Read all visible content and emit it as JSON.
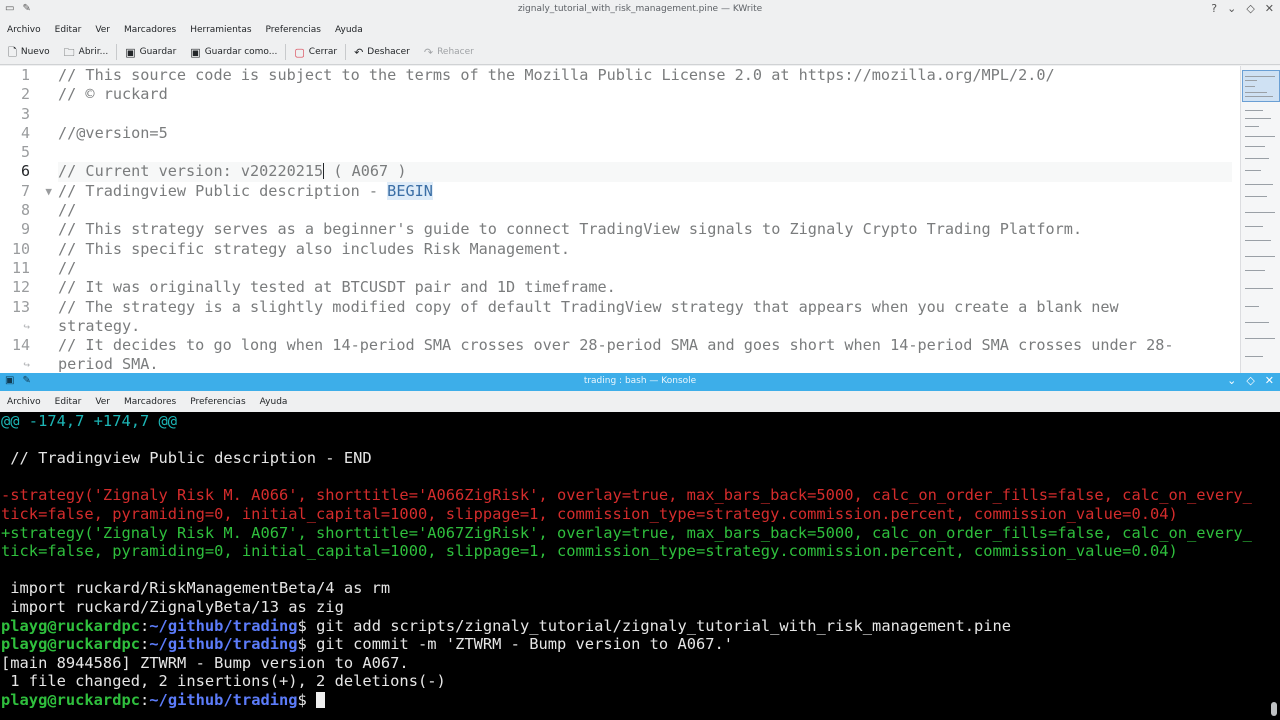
{
  "kwrite": {
    "title": "zignaly_tutorial_with_risk_management.pine — KWrite",
    "menu": [
      "Archivo",
      "Editar",
      "Ver",
      "Marcadores",
      "Herramientas",
      "Preferencias",
      "Ayuda"
    ],
    "toolbar": {
      "new_label": "Nuevo",
      "open_label": "Abrir...",
      "save_label": "Guardar",
      "save_as_label": "Guardar como...",
      "close_label": "Cerrar",
      "undo_label": "Deshacer",
      "redo_label": "Rehacer"
    },
    "gutter": [
      "1",
      "2",
      "3",
      "4",
      "5",
      "6",
      "7",
      "8",
      "9",
      "10",
      "11",
      "12",
      "13",
      "",
      "14",
      ""
    ],
    "lines": {
      "l1": "// This source code is subject to the terms of the Mozilla Public License 2.0 at https://mozilla.org/MPL/2.0/",
      "l2": "// © ruckard",
      "l3": "",
      "l4": "//@version=5",
      "l5": "",
      "l6_before_cursor": "// Current version: v20220215",
      "l6_after_cursor": " ( A067 )",
      "l7_prefix": "// Tradingview Public description - ",
      "l7_highlight": "BEGIN",
      "l8": "//",
      "l9": "// This strategy serves as a beginner's guide to connect TradingView signals to Zignaly Crypto Trading Platform.",
      "l10": "// This specific strategy also includes Risk Management.",
      "l11": "//",
      "l12": "// It was originally tested at BTCUSDT pair and 1D timeframe.",
      "l13a": "// The strategy is a slightly modified copy of default TradingView strategy that appears when you create a blank new",
      "l13b": "strategy.",
      "l14a": "// It decides to go long when 14-period SMA crosses over 28-period SMA and goes short when 14-period SMA crosses under 28-",
      "l14b": "period SMA."
    }
  },
  "konsole": {
    "title": "trading : bash — Konsole",
    "menu": [
      "Archivo",
      "Editar",
      "Ver",
      "Marcadores",
      "Preferencias",
      "Ayuda"
    ],
    "terminal": {
      "hunk": "@@ -174,7 +174,7 @@",
      "blank1": "",
      "ctx1": " // Tradingview Public description - END",
      "blank2": "",
      "del1": "-strategy('Zignaly Risk M. A066', shorttitle='A066ZigRisk', overlay=true, max_bars_back=5000, calc_on_order_fills=false, calc_on_every_",
      "del2": "tick=false, pyramiding=0, initial_capital=1000, slippage=1, commission_type=strategy.commission.percent, commission_value=0.04)",
      "add1": "+strategy('Zignaly Risk M. A067', shorttitle='A067ZigRisk', overlay=true, max_bars_back=5000, calc_on_order_fills=false, calc_on_every_",
      "add2": "tick=false, pyramiding=0, initial_capital=1000, slippage=1, commission_type=strategy.commission.percent, commission_value=0.04)",
      "blank3": "",
      "ctx2": " import ruckard/RiskManagementBeta/4 as rm",
      "ctx3": " import ruckard/ZignalyBeta/13 as zig",
      "prompt_user": "playg@ruckardpc",
      "prompt_sep": ":",
      "prompt_path": "~/github/trading",
      "prompt_dollar": "$ ",
      "cmd1": "git add scripts/zignaly_tutorial/zignaly_tutorial_with_risk_management.pine",
      "cmd2": "git commit -m 'ZTWRM - Bump version to A067.'",
      "out1": "[main 8944586] ZTWRM - Bump version to A067.",
      "out2": " 1 file changed, 2 insertions(+), 2 deletions(-)"
    }
  }
}
